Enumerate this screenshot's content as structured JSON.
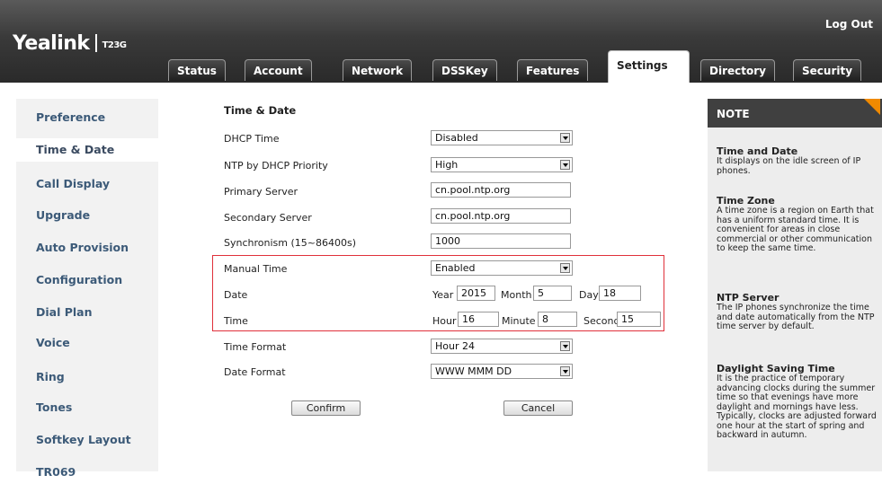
{
  "header": {
    "logout": "Log Out",
    "brand": "Yealink",
    "model": "T23G",
    "tabs": [
      {
        "label": "Status"
      },
      {
        "label": "Account"
      },
      {
        "label": "Network"
      },
      {
        "label": "DSSKey"
      },
      {
        "label": "Features"
      },
      {
        "label": "Settings"
      },
      {
        "label": "Directory"
      },
      {
        "label": "Security"
      }
    ],
    "active_tab": "Settings"
  },
  "sidebar": {
    "items": [
      {
        "label": "Preference"
      },
      {
        "label": "Time & Date"
      },
      {
        "label": "Call Display"
      },
      {
        "label": "Upgrade"
      },
      {
        "label": "Auto Provision"
      },
      {
        "label": "Configuration"
      },
      {
        "label": "Dial Plan"
      },
      {
        "label": "Voice"
      },
      {
        "label": "Ring"
      },
      {
        "label": "Tones"
      },
      {
        "label": "Softkey Layout"
      },
      {
        "label": "TR069"
      }
    ],
    "active_item": "Time & Date"
  },
  "form": {
    "title": "Time & Date",
    "dhcp_time": {
      "label": "DHCP Time",
      "value": "Disabled"
    },
    "ntp_priority": {
      "label": "NTP by DHCP Priority",
      "value": "High"
    },
    "primary_server": {
      "label": "Primary Server",
      "value": "cn.pool.ntp.org"
    },
    "secondary_server": {
      "label": "Secondary Server",
      "value": "cn.pool.ntp.org"
    },
    "synchronism": {
      "label": "Synchronism (15~86400s)",
      "value": "1000"
    },
    "manual_time": {
      "label": "Manual Time",
      "value": "Enabled"
    },
    "date": {
      "label": "Date",
      "year_label": "Year",
      "year": "2015",
      "month_label": "Month",
      "month": "5",
      "day_label": "Day",
      "day": "18"
    },
    "time": {
      "label": "Time",
      "hour_label": "Hour",
      "hour": "16",
      "minute_label": "Minute",
      "minute": "8",
      "second_label": "Second",
      "second": "15"
    },
    "time_format": {
      "label": "Time Format",
      "value": "Hour 24"
    },
    "date_format": {
      "label": "Date Format",
      "value": "WWW MMM DD"
    },
    "confirm_label": "Confirm",
    "cancel_label": "Cancel"
  },
  "note": {
    "title": "NOTE",
    "sections": [
      {
        "heading": "Time and Date",
        "text": "It displays on the idle screen of IP phones."
      },
      {
        "heading": "Time Zone",
        "text": "A time zone is a region on Earth that has a uniform standard time. It is convenient for areas in close commercial or other communication to keep the same time."
      },
      {
        "heading": "NTP Server",
        "text": "The IP phones synchronize the time and date automatically from the NTP time server by default."
      },
      {
        "heading": "Daylight Saving Time",
        "text": "It is the practice of temporary advancing clocks during the summer time so that evenings have more daylight and mornings have less. Typically, clocks are adjusted forward one hour at the start of spring and backward in autumn."
      }
    ]
  },
  "colors": {
    "header_bg": "#3a3a3a",
    "sidebar_text": "#3c5a78",
    "highlight_border": "#e0303a",
    "note_accent": "#f08a00"
  }
}
